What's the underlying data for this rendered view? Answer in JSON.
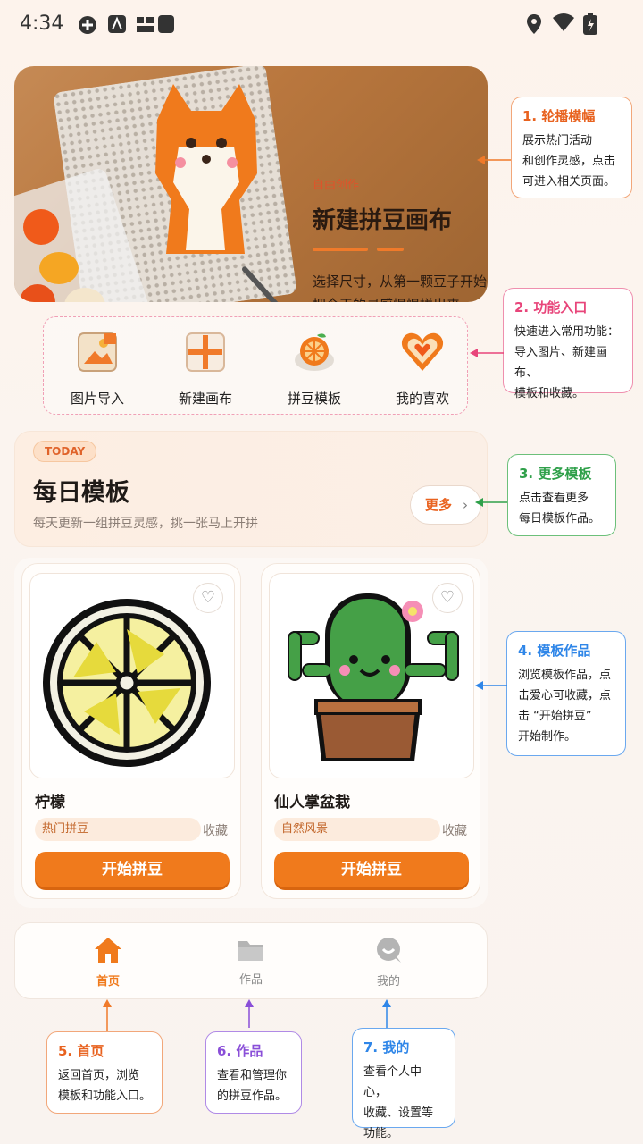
{
  "status_bar": {
    "time": "4:34"
  },
  "banner": {
    "tag": "自由创作",
    "title": "新建拼豆画布",
    "desc_line1": "选择尺寸，从第一颗豆子开始",
    "desc_line2": "把今天的灵感慢慢拼出来"
  },
  "quick_entries": [
    {
      "label": "图片导入",
      "icon": "image-import-icon"
    },
    {
      "label": "新建画布",
      "icon": "new-canvas-icon"
    },
    {
      "label": "拼豆模板",
      "icon": "template-icon"
    },
    {
      "label": "我的喜欢",
      "icon": "heart-icon"
    }
  ],
  "daily": {
    "badge": "TODAY",
    "title": "每日模板",
    "subtitle": "每天更新一组拼豆灵感，挑一张马上开拼",
    "more_label": "更多"
  },
  "cards": [
    {
      "title": "柠檬",
      "tag": "热门拼豆",
      "fav": "收藏",
      "button": "开始拼豆"
    },
    {
      "title": "仙人掌盆栽",
      "tag": "自然风景",
      "fav": "收藏",
      "button": "开始拼豆"
    }
  ],
  "bottom_nav": [
    {
      "label": "首页",
      "icon": "home-icon",
      "active": true
    },
    {
      "label": "作品",
      "icon": "folder-icon",
      "active": false
    },
    {
      "label": "我的",
      "icon": "profile-icon",
      "active": false
    }
  ],
  "callouts": {
    "c1": {
      "title": "1. 轮播横幅",
      "lines": [
        "展示热门活动",
        "和创作灵感，点击",
        "可进入相关页面。"
      ],
      "color": "#f07a2a"
    },
    "c2": {
      "title": "2. 功能入口",
      "lines": [
        "快速进入常用功能：",
        "导入图片、新建画布、",
        "模板和收藏。"
      ],
      "color": "#e8457a"
    },
    "c3": {
      "title": "3. 更多模板",
      "lines": [
        "点击查看更多",
        "每日模板作品。"
      ],
      "color": "#2fa04a"
    },
    "c4": {
      "title": "4. 模板作品",
      "lines": [
        "浏览模板作品，点",
        "击爱心可收藏，点",
        "击 “开始拼豆”",
        "开始制作。"
      ],
      "color": "#2f86e8"
    },
    "c5": {
      "title": "5. 首页",
      "lines": [
        "返回首页，浏览",
        "模板和功能入口。"
      ],
      "color": "#f07a2a"
    },
    "c6": {
      "title": "6. 作品",
      "lines": [
        "查看和管理你",
        "的拼豆作品。"
      ],
      "color": "#8a4fd8"
    },
    "c7": {
      "title": "7. 我的",
      "lines": [
        "查看个人中心，",
        "收藏、设置等",
        "功能。"
      ],
      "color": "#2f86e8"
    }
  },
  "colors": {
    "accent": "#f07a1c",
    "nav_active": "#f07a1c",
    "nav_inactive": "#9a9a9a"
  }
}
